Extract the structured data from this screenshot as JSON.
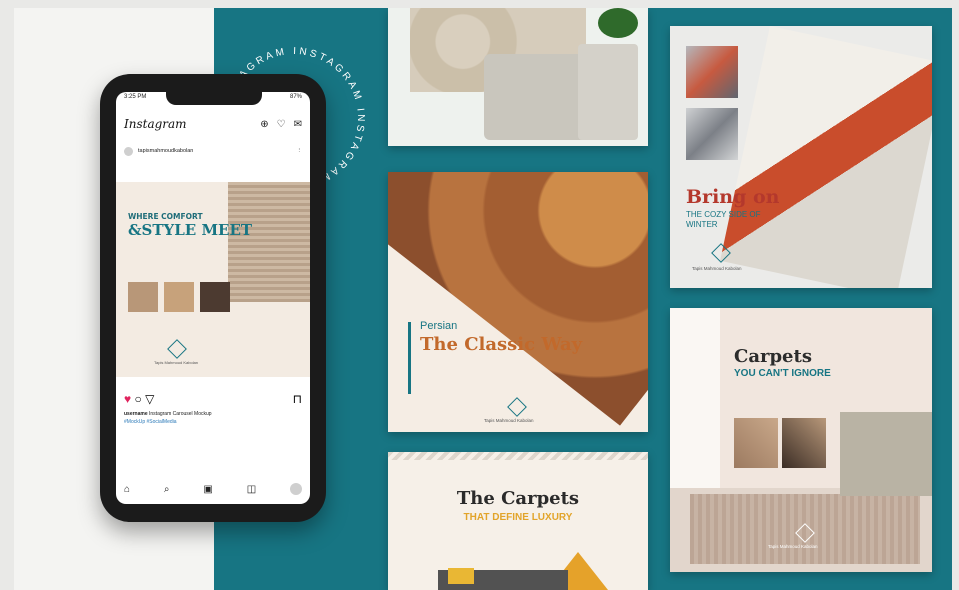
{
  "circle_text": "INSTAGRAM INSTAGRAM INSTAGRAM INS",
  "phone": {
    "time": "3:25 PM",
    "battery": "87%",
    "app_name": "Instagram",
    "account": "tapismahmoudkabolan",
    "post": {
      "heading_small": "WHERE COMFORT",
      "heading_big": "&STYLE MEET",
      "brand": "Tapis Mahmoud Kabolan"
    },
    "caption_user": "username",
    "caption_text": "Instagram Carousel Mockup",
    "caption_tags": "#MockUp #SocialMedia"
  },
  "cards": {
    "bring_on": {
      "title": "Bring on",
      "subtitle": "THE COZY SIDE OF WINTER",
      "brand": "Tapis Mahmoud Kabolan"
    },
    "persian": {
      "kicker": "Persian",
      "title": "The Classic Way",
      "brand": "Tapis Mahmoud Kabolan"
    },
    "carpets_ignore": {
      "title": "Carpets",
      "subtitle": "YOU CAN'T IGNORE",
      "brand": "Tapis Mahmoud Kabolan"
    },
    "carpets_luxury": {
      "title": "The Carpets",
      "subtitle": "THAT DEFINE LUXURY"
    }
  },
  "colors": {
    "teal": "#177583",
    "red": "#b4382c",
    "orange": "#c2692b",
    "gold": "#e2a42a"
  }
}
